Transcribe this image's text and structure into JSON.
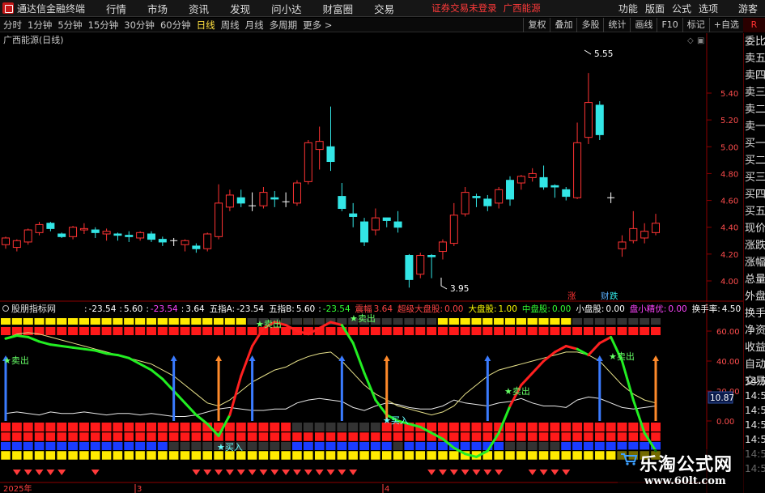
{
  "app": {
    "title": "通达信金融终端",
    "menu": [
      "行情",
      "市场",
      "资讯",
      "发现",
      "问小达",
      "财富圈",
      "交易"
    ],
    "status_text": "证券交易未登录",
    "stock_name": "广西能源",
    "right_menu": [
      "功能",
      "版面",
      "公式",
      "选项"
    ],
    "guest_label": "游客"
  },
  "periods": {
    "items": [
      "分时",
      "1分钟",
      "5分钟",
      "15分钟",
      "30分钟",
      "60分钟",
      "日线",
      "周线",
      "月线",
      "多周期",
      "更多 >"
    ],
    "active": "日线"
  },
  "toolbar": {
    "buttons": [
      "复权",
      "叠加",
      "多股",
      "统计",
      "画线",
      "F10",
      "标记",
      "+自选"
    ],
    "badge": "R"
  },
  "main_chart": {
    "title": "广西能源(日线)",
    "y_ticks": [
      "5.40",
      "5.20",
      "5.00",
      "4.80",
      "4.60",
      "4.40",
      "4.20",
      "4.00"
    ],
    "high_label": "5.55",
    "low_label": "3.95",
    "legend_up": "涨",
    "legend_down": "跌",
    "legend_finance": "财",
    "colors": {
      "up": "#ff3333",
      "down": "#33e6e6",
      "flat": "#ffffff"
    }
  },
  "indicator": {
    "name": "股朋指标网",
    "values_line": [
      {
        "label": "",
        "value": "-23.54",
        "color": "#ffffff"
      },
      {
        "label": "",
        "value": "5.60",
        "color": "#ffffff"
      },
      {
        "label": "",
        "value": "-23.54",
        "color": "#ff44ff"
      },
      {
        "label": "",
        "value": "3.64",
        "color": "#ffffff"
      },
      {
        "label": "五指A:",
        "value": "-23.54",
        "color": "#ffffff"
      },
      {
        "label": "五指B:",
        "value": "5.60",
        "color": "#ffffff"
      },
      {
        "label": "",
        "value": "-23.54",
        "color": "#33ff33"
      },
      {
        "label": "震幅",
        "value": "3.64",
        "color": "#ff4444"
      },
      {
        "label": "超级大盘股:",
        "value": "0.00",
        "color": "#ff4444"
      },
      {
        "label": "大盘股:",
        "value": "1.00",
        "color": "#ffff00"
      },
      {
        "label": "中盘股:",
        "value": "0.00",
        "color": "#33ff33"
      },
      {
        "label": "小盘股:",
        "value": "0.00",
        "color": "#ffffff"
      },
      {
        "label": "盘小精优:",
        "value": "0.00",
        "color": "#ff44ff"
      },
      {
        "label": "换手率:",
        "value": "4.50",
        "color": "#ffffff"
      }
    ],
    "y_ticks": [
      "60.00",
      "40.00",
      "20.00",
      "0.00"
    ],
    "current_value": "10.87",
    "sell_label": "卖出",
    "buy_label": "买入",
    "x_year": "2025年",
    "x_marks": [
      "3",
      "4"
    ]
  },
  "quote_panel": {
    "labels": [
      "委比",
      "卖五",
      "卖四",
      "卖三",
      "卖二",
      "卖一",
      "买一",
      "买二",
      "买三",
      "买四",
      "买五",
      "现价",
      "涨跌",
      "涨幅",
      "总量",
      "外盘",
      "换手",
      "净资",
      "收益",
      "自动",
      "交易"
    ],
    "times": [
      "14:5",
      "14:5",
      "14:5",
      "14:5",
      "14:5",
      "14:5",
      "14:5"
    ]
  },
  "watermark": {
    "title": "乐淘公式网",
    "url": "www.60lt.com"
  },
  "chart_data": {
    "type": "candlestick",
    "y_range": [
      3.9,
      5.6
    ],
    "candles": [
      [
        4.27,
        4.32,
        4.24,
        4.33
      ],
      [
        4.25,
        4.3,
        4.22,
        4.31
      ],
      [
        4.29,
        4.38,
        4.27,
        4.39
      ],
      [
        4.36,
        4.42,
        4.34,
        4.44
      ],
      [
        4.43,
        4.39,
        4.37,
        4.44
      ],
      [
        4.35,
        4.33,
        4.32,
        4.36
      ],
      [
        4.33,
        4.4,
        4.31,
        4.41
      ],
      [
        4.38,
        4.39,
        4.35,
        4.43
      ],
      [
        4.38,
        4.36,
        4.32,
        4.4
      ],
      [
        4.35,
        4.37,
        4.3,
        4.39
      ],
      [
        4.35,
        4.34,
        4.3,
        4.36
      ],
      [
        4.34,
        4.33,
        4.29,
        4.37
      ],
      [
        4.32,
        4.36,
        4.3,
        4.37
      ],
      [
        4.35,
        4.31,
        4.29,
        4.37
      ],
      [
        4.31,
        4.29,
        4.26,
        4.33
      ],
      [
        4.3,
        4.3,
        4.26,
        4.32
      ],
      [
        4.27,
        4.3,
        4.22,
        4.31
      ],
      [
        4.26,
        4.24,
        4.21,
        4.28
      ],
      [
        4.24,
        4.35,
        4.22,
        4.36
      ],
      [
        4.33,
        4.58,
        4.31,
        4.72
      ],
      [
        4.55,
        4.64,
        4.52,
        4.68
      ],
      [
        4.62,
        4.58,
        4.55,
        4.68
      ],
      [
        4.56,
        4.56,
        4.52,
        4.66
      ],
      [
        4.56,
        4.66,
        4.54,
        4.7
      ],
      [
        4.62,
        4.61,
        4.55,
        4.67
      ],
      [
        4.59,
        4.59,
        4.55,
        4.66
      ],
      [
        4.58,
        4.73,
        4.56,
        4.75
      ],
      [
        4.74,
        5.03,
        4.72,
        5.05
      ],
      [
        4.98,
        5.04,
        4.83,
        5.15
      ],
      [
        5.0,
        4.89,
        4.82,
        5.3
      ],
      [
        4.63,
        4.54,
        4.52,
        4.73
      ],
      [
        4.5,
        4.48,
        4.4,
        4.58
      ],
      [
        4.44,
        4.29,
        4.26,
        4.47
      ],
      [
        4.38,
        4.47,
        4.34,
        4.54
      ],
      [
        4.47,
        4.45,
        4.4,
        4.47
      ],
      [
        4.44,
        4.4,
        4.36,
        4.52
      ],
      [
        4.19,
        4.01,
        3.95,
        4.2
      ],
      [
        4.05,
        4.19,
        4.02,
        4.21
      ],
      [
        4.19,
        4.18,
        4.02,
        4.2
      ],
      [
        4.22,
        4.29,
        4.16,
        4.31
      ],
      [
        4.28,
        4.49,
        4.26,
        4.58
      ],
      [
        4.5,
        4.66,
        4.48,
        4.7
      ],
      [
        4.63,
        4.62,
        4.55,
        4.65
      ],
      [
        4.61,
        4.56,
        4.52,
        4.64
      ],
      [
        4.58,
        4.68,
        4.54,
        4.7
      ],
      [
        4.75,
        4.61,
        4.56,
        4.78
      ],
      [
        4.73,
        4.78,
        4.68,
        4.79
      ],
      [
        4.77,
        4.8,
        4.74,
        4.84
      ],
      [
        4.77,
        4.7,
        4.68,
        4.86
      ],
      [
        4.71,
        4.7,
        4.62,
        4.72
      ],
      [
        4.68,
        4.63,
        4.6,
        4.7
      ],
      [
        4.62,
        5.03,
        4.61,
        5.18
      ],
      [
        5.07,
        5.33,
        5.02,
        5.55
      ],
      [
        5.31,
        5.09,
        5.05,
        5.34
      ],
      [
        4.62,
        4.62,
        4.58,
        4.66
      ],
      [
        4.24,
        4.29,
        4.18,
        4.34
      ],
      [
        4.3,
        4.39,
        4.28,
        4.52
      ],
      [
        4.32,
        4.37,
        4.28,
        4.43
      ],
      [
        4.36,
        4.43,
        4.34,
        4.5
      ]
    ]
  }
}
